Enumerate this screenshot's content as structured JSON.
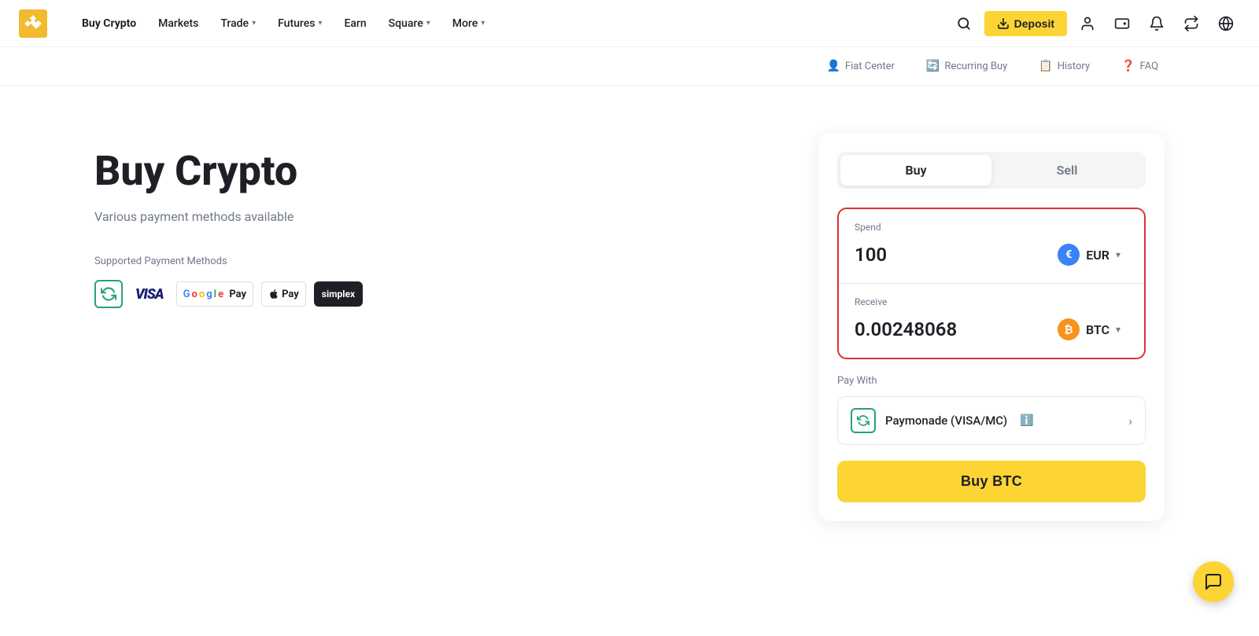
{
  "navbar": {
    "logo_text": "Binance",
    "nav_links": [
      {
        "id": "buy-crypto",
        "label": "Buy Crypto",
        "has_dropdown": false,
        "active": true
      },
      {
        "id": "markets",
        "label": "Markets",
        "has_dropdown": false
      },
      {
        "id": "trade",
        "label": "Trade",
        "has_dropdown": true
      },
      {
        "id": "futures",
        "label": "Futures",
        "has_dropdown": true
      },
      {
        "id": "earn",
        "label": "Earn",
        "has_dropdown": false
      },
      {
        "id": "square",
        "label": "Square",
        "has_dropdown": true
      },
      {
        "id": "more",
        "label": "More",
        "has_dropdown": true
      }
    ],
    "deposit_label": "Deposit"
  },
  "sub_nav": {
    "items": [
      {
        "id": "fiat-center",
        "label": "Fiat Center",
        "icon": "👤"
      },
      {
        "id": "recurring-buy",
        "label": "Recurring Buy",
        "icon": "🔄"
      },
      {
        "id": "history",
        "label": "History",
        "icon": "📋"
      },
      {
        "id": "faq",
        "label": "FAQ",
        "icon": "❓"
      }
    ]
  },
  "hero": {
    "title": "Buy Crypto",
    "subtitle": "Various payment methods available",
    "payment_methods_label": "Supported Payment Methods"
  },
  "widget": {
    "tabs": [
      {
        "id": "buy",
        "label": "Buy",
        "active": true
      },
      {
        "id": "sell",
        "label": "Sell",
        "active": false
      }
    ],
    "spend": {
      "label": "Spend",
      "amount": "100",
      "currency": "EUR"
    },
    "receive": {
      "label": "Receive",
      "amount": "0.00248068",
      "currency": "BTC"
    },
    "pay_with": {
      "label": "Pay With",
      "method": "Paymonade (VISA/MC)",
      "info_icon": "ℹ"
    },
    "buy_button_label": "Buy BTC"
  }
}
